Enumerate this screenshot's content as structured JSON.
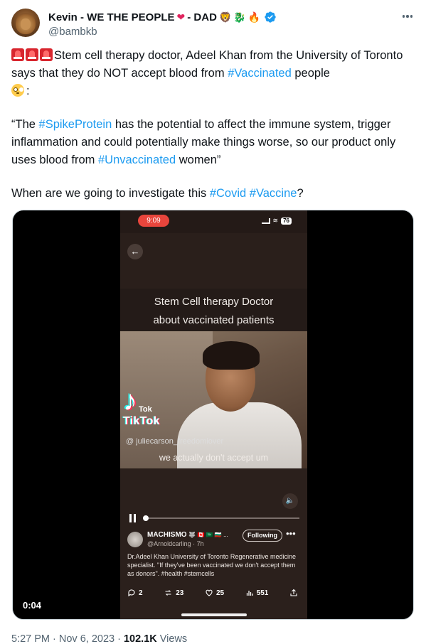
{
  "author": {
    "display_name": "Kevin - WE THE PEOPLE",
    "name_suffix": "- DAD",
    "name_emojis": [
      "❤",
      "🦁",
      "🐉",
      "🔥"
    ],
    "handle": "@bambkb",
    "verified_icon": "verified-badge-icon"
  },
  "tweet": {
    "line1_prefix": "Stem cell therapy doctor, Adeel Khan from the University of Toronto says that they do NOT accept blood from ",
    "tag_vaccinated": "#Vaccinated",
    "line1_suffix": " people",
    "line1_end": ":",
    "quote_open": "“The ",
    "tag_spike": "#SpikeProtein",
    "quote_middle": " has the potential to affect the immune system, trigger inflammation and could potentially make things worse, so our product only uses blood from ",
    "tag_unvaccinated": "#Unvaccinated",
    "quote_close": " women”",
    "question_prefix": "When are we going to investigate this ",
    "tag_covid": "#Covid",
    "tag_vaccine": "#Vaccine",
    "question_end": "?"
  },
  "video": {
    "phone_time": "9:09",
    "battery": "76",
    "caption_line1": "Stem Cell therapy Doctor",
    "caption_line2": "about vaccinated patients",
    "tiktok_small": "Tok",
    "tiktok_label": "TikTok",
    "tiktok_user": "@ juliecarson_freedomlover",
    "subtitle": "we actually don't accept um",
    "inner_post": {
      "name": "MACHISMO",
      "name_emojis": "🐺 🇨🇦 🇸🇦 🇧🇬 ...",
      "handle": "@Arnoldcarling · 7h",
      "follow_label": "Following",
      "more_label": "•••",
      "text": "Dr.Adeel Khan University of Toronto Regenerative medicine specialist.  \"If they've been vaccinated we don't accept them as donors\". #health #stemcells",
      "replies": "2",
      "reposts": "23",
      "likes": "25",
      "views": "551"
    },
    "timecode": "0:04"
  },
  "meta": {
    "time": "5:27 PM · Nov 6, 2023 · ",
    "views_count": "102.1K",
    "views_label": " Views"
  }
}
